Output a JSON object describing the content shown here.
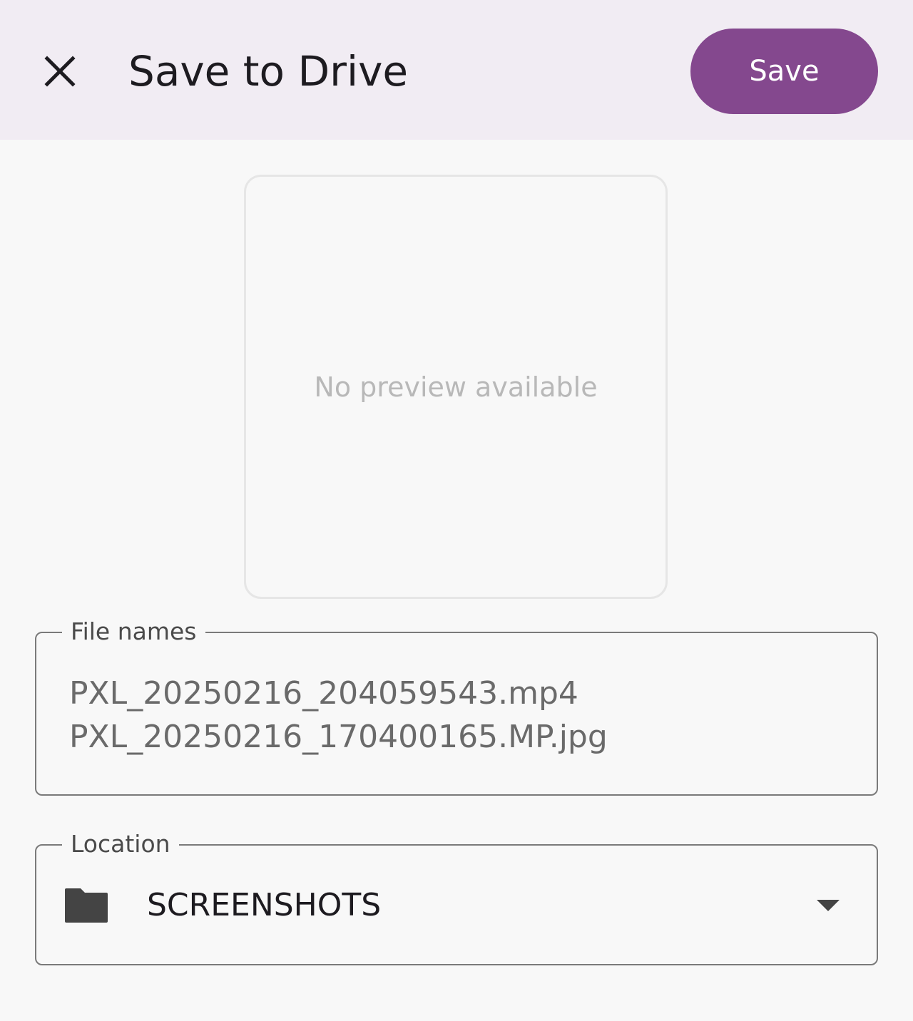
{
  "header": {
    "title": "Save to Drive",
    "save_label": "Save",
    "close_icon": "close-icon"
  },
  "preview": {
    "message": "No preview available"
  },
  "file_names": {
    "label": "File names",
    "items": [
      "PXL_20250216_204059543.mp4",
      "PXL_20250216_170400165.MP.jpg"
    ]
  },
  "location": {
    "label": "Location",
    "value": "SCREENSHOTS",
    "folder_icon": "folder-icon",
    "dropdown_icon": "dropdown-arrow-icon"
  },
  "colors": {
    "header_bg": "#f1ecf3",
    "accent": "#84488e",
    "background": "#f8f8f8"
  }
}
